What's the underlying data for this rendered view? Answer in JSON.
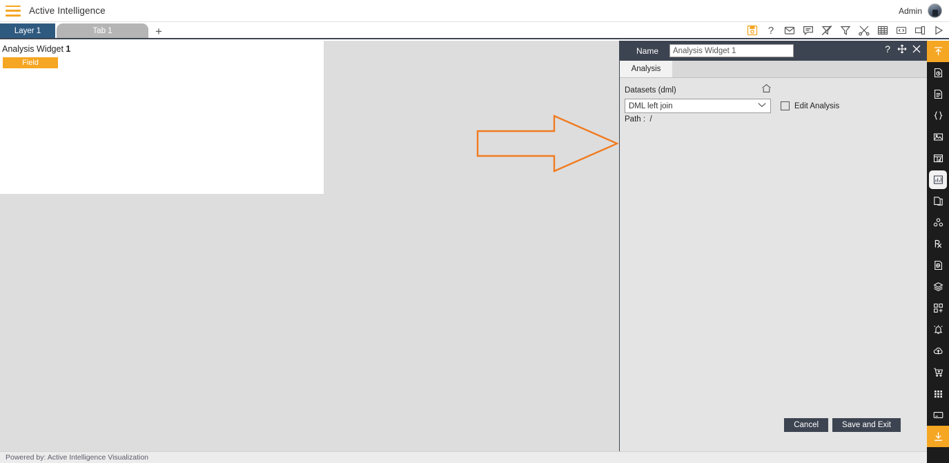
{
  "header": {
    "menu_icon": "hamburger-icon",
    "app_title": "Active Intelligence",
    "user_label": "Admin",
    "avatar_icon": "user-avatar"
  },
  "tabstrip": {
    "layer_tab": "Layer 1",
    "page_tab": "Tab 1",
    "add_tab": "+",
    "toolbar_icons": [
      {
        "name": "save-icon",
        "title": "Save"
      },
      {
        "name": "help-icon",
        "title": "Help"
      },
      {
        "name": "mail-icon",
        "title": "Mail"
      },
      {
        "name": "comment-icon",
        "title": "Comment"
      },
      {
        "name": "clear-filter-icon",
        "title": "Clear Filter"
      },
      {
        "name": "filter-icon",
        "title": "Filter"
      },
      {
        "name": "tools-icon",
        "title": "Tools"
      },
      {
        "name": "table-icon",
        "title": "Table"
      },
      {
        "name": "code-icon",
        "title": "Code"
      },
      {
        "name": "duplicate-icon",
        "title": "Duplicate"
      },
      {
        "name": "run-icon",
        "title": "Run"
      }
    ]
  },
  "canvas": {
    "widget_title_prefix": "Analysis Widget ",
    "widget_title_number": "1",
    "field_chip_label": "Field",
    "annotation_icon": "orange-right-arrow",
    "annotation_color": "#F07B20"
  },
  "panel": {
    "name_label": "Name",
    "name_value": "Analysis Widget 1",
    "title_icons": [
      {
        "name": "help-icon",
        "glyph": "?"
      },
      {
        "name": "move-icon",
        "glyph": "move"
      },
      {
        "name": "close-icon",
        "glyph": "x"
      }
    ],
    "tabs": [
      {
        "label": "Analysis",
        "active": true
      }
    ],
    "datasets_label": "Datasets (dml)",
    "home_icon": "home-icon",
    "dataset_selected": "DML left join",
    "dataset_options": [
      "DML left join"
    ],
    "edit_analysis_label": "Edit Analysis",
    "edit_analysis_checked": false,
    "path_label": "Path :",
    "path_value": "/",
    "cancel_label": "Cancel",
    "save_label": "Save and Exit"
  },
  "rail": {
    "items": [
      {
        "name": "collapse-up-icon",
        "state": "accent"
      },
      {
        "name": "page-refresh-icon",
        "state": "normal"
      },
      {
        "name": "document-icon",
        "state": "normal"
      },
      {
        "name": "braces-icon",
        "state": "normal"
      },
      {
        "name": "image-icon",
        "state": "normal"
      },
      {
        "name": "media-panel-icon",
        "state": "normal"
      },
      {
        "name": "chart-icon",
        "state": "active"
      },
      {
        "name": "copy-page-icon",
        "state": "normal"
      },
      {
        "name": "cluster-icon",
        "state": "normal"
      },
      {
        "name": "prescription-icon",
        "state": "normal"
      },
      {
        "name": "script-icon",
        "state": "normal"
      },
      {
        "name": "layers-icon",
        "state": "normal"
      },
      {
        "name": "add-widget-icon",
        "state": "normal"
      },
      {
        "name": "alert-bell-icon",
        "state": "normal"
      },
      {
        "name": "cloud-upload-icon",
        "state": "normal"
      },
      {
        "name": "add-to-cart-icon",
        "state": "normal"
      },
      {
        "name": "grid-icon",
        "state": "normal"
      },
      {
        "name": "window-icon",
        "state": "normal"
      },
      {
        "name": "collapse-down-icon",
        "state": "accent"
      }
    ]
  },
  "footer": {
    "text": "Powered by: Active Intelligence Visualization"
  },
  "colors": {
    "accent_orange": "#F5A623",
    "annotation_orange": "#F07B20",
    "dark_chrome": "#3d4451",
    "layer_tab_blue": "#2f5a80",
    "rail_dark": "#1c1c1c"
  }
}
